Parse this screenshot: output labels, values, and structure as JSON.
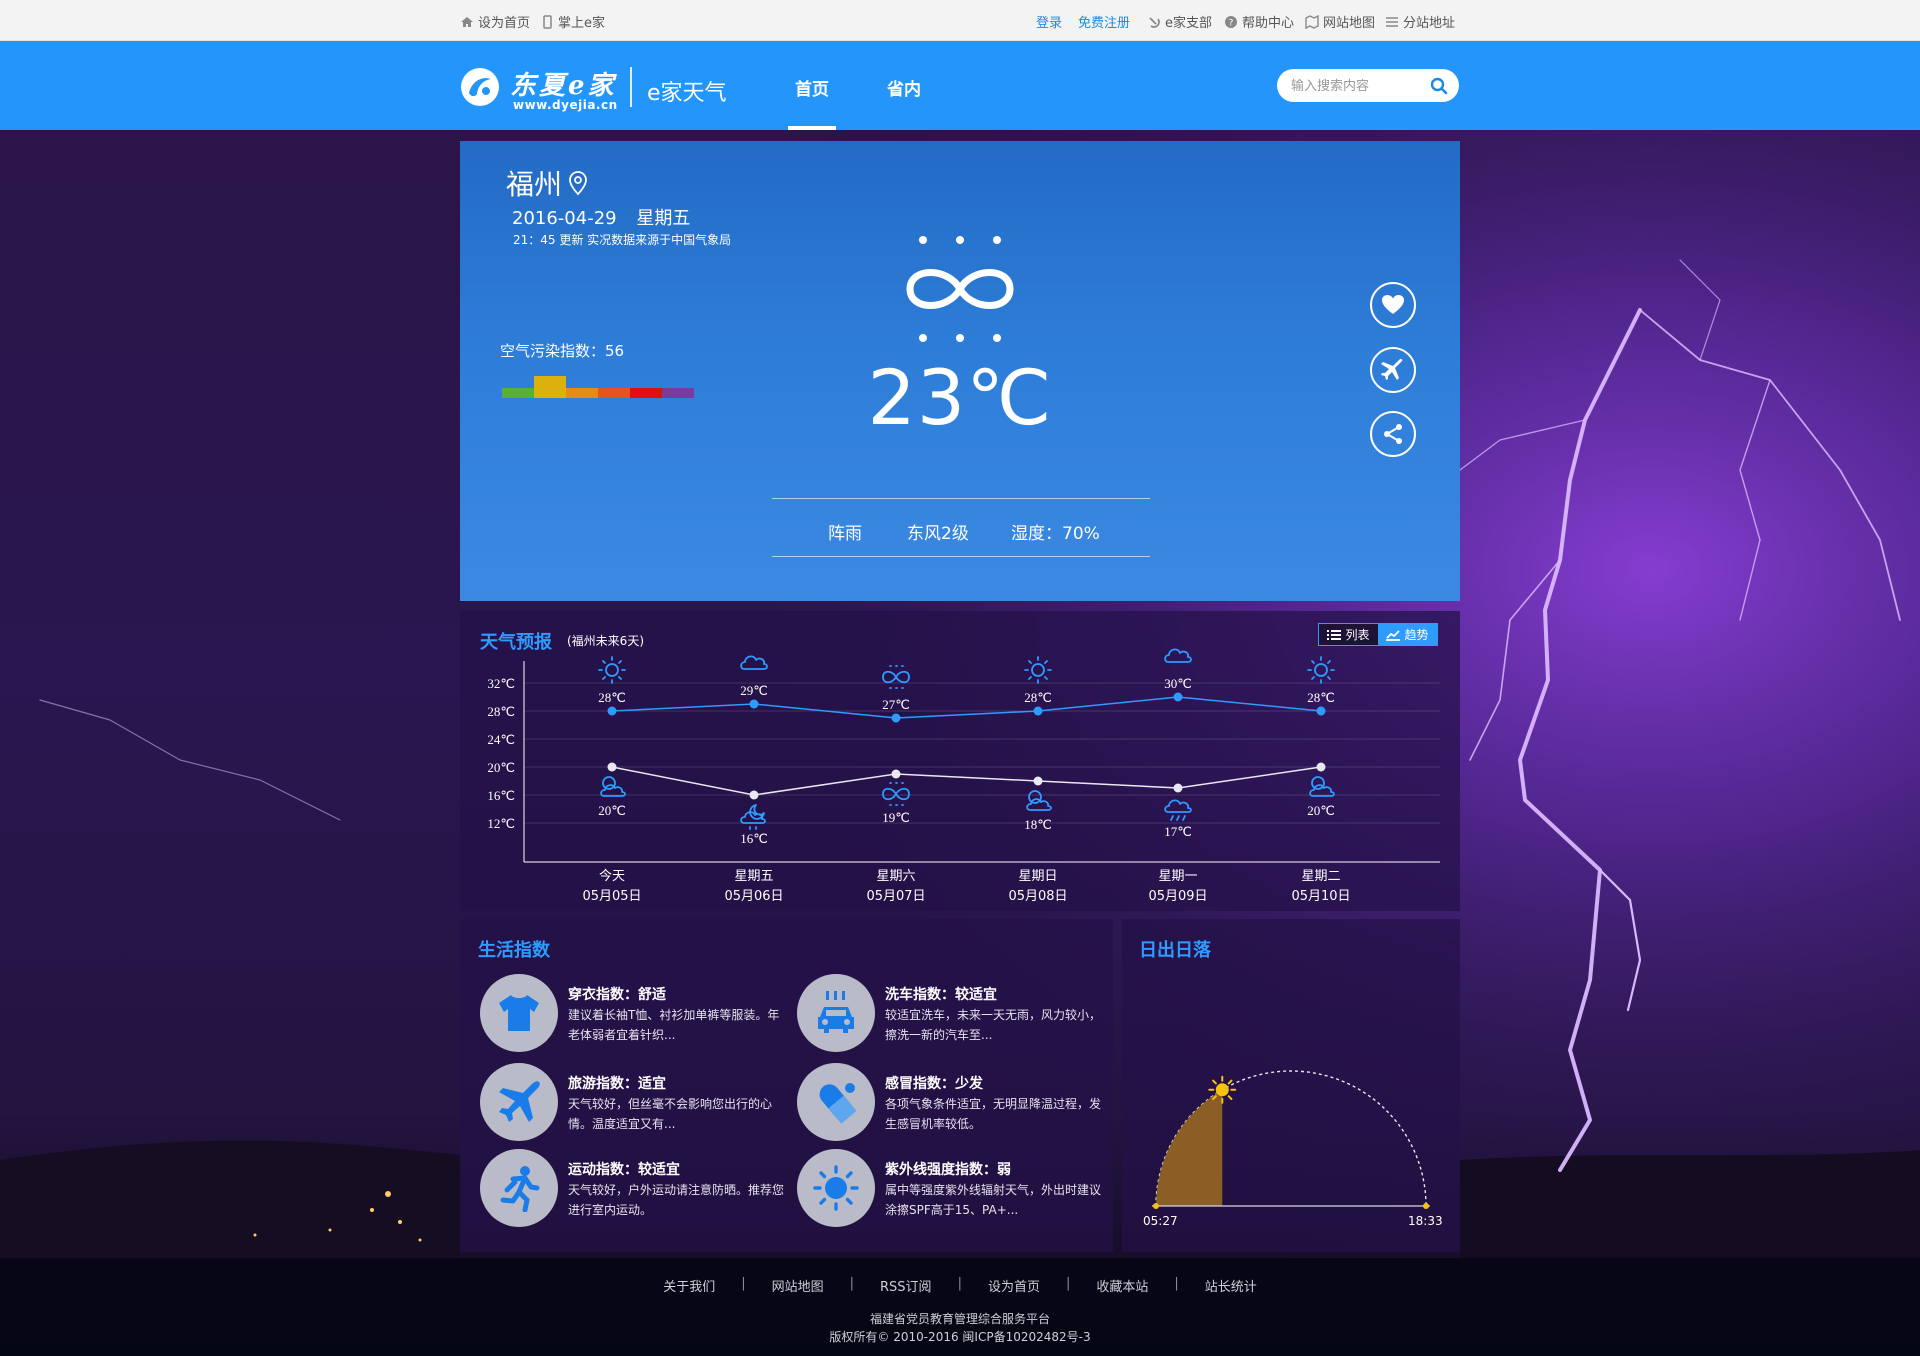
{
  "topbar": {
    "set_home": "设为首页",
    "mobile": "掌上e家",
    "login": "登录",
    "register": "免费注册",
    "branch": "e家支部",
    "help": "帮助中心",
    "sitemap": "网站地图",
    "substations": "分站地址"
  },
  "header": {
    "logo_text": "东夏e家",
    "logo_url": "www.dyejia.cn",
    "site_name": "e家天气",
    "nav": [
      "首页",
      "省内"
    ],
    "active_nav": "首页",
    "search_placeholder": "输入搜索内容"
  },
  "current": {
    "city": "福州",
    "date": "2016-04-29",
    "weekday": "星期五",
    "update": "21：45 更新 实况数据来源于中国气象局",
    "aqi_label": "空气污染指数：56",
    "aqi_value": 56,
    "aqi_colors": [
      "#5ab035",
      "#dcb10e",
      "#e8891b",
      "#e2561e",
      "#e01010",
      "#7a3aa0"
    ],
    "icon": "haze-icon",
    "temperature": "23℃",
    "condition": "阵雨",
    "wind": "东风2级",
    "humidity": "湿度：70%"
  },
  "forecast": {
    "title": "天气预报",
    "subtitle": "(福州未来6天)",
    "toggle_list": "列表",
    "toggle_trend": "趋势",
    "active_view": "趋势",
    "colors": {
      "high": "#2e9bff",
      "low": "#e8e8f0",
      "axis": "#ffffff"
    }
  },
  "chart_data": {
    "type": "line",
    "ylabels": [
      "32℃",
      "28℃",
      "24℃",
      "20℃",
      "16℃",
      "12℃"
    ],
    "yticks": [
      32,
      28,
      24,
      20,
      16,
      12
    ],
    "categories": [
      "今天",
      "星期五",
      "星期六",
      "星期日",
      "星期一",
      "星期二"
    ],
    "dates": [
      "05月05日",
      "05月06日",
      "05月07日",
      "05月08日",
      "05月09日",
      "05月10日"
    ],
    "series": [
      {
        "key": "high",
        "values": [
          28,
          29,
          27,
          28,
          30,
          28
        ],
        "labels": [
          "28℃",
          "29℃",
          "27℃",
          "28℃",
          "30℃",
          "28℃"
        ],
        "icons": [
          "sun-icon",
          "cloud-icon",
          "haze-icon",
          "sun-icon",
          "cloud-icon",
          "sun-icon"
        ]
      },
      {
        "key": "low",
        "values": [
          20,
          16,
          19,
          18,
          17,
          20
        ],
        "labels": [
          "20℃",
          "16℃",
          "19℃",
          "18℃",
          "17℃",
          "20℃"
        ],
        "icons": [
          "partly-cloudy-icon",
          "night-cloudy-icon",
          "haze-icon",
          "partly-cloudy-icon",
          "rain-night-icon",
          "partly-cloudy-icon"
        ]
      }
    ]
  },
  "life": {
    "title": "生活指数",
    "items": [
      {
        "icon": "tshirt-icon",
        "title": "穿衣指数：舒适",
        "desc": "建议着长袖T恤、衬衫加单裤等服装。年老体弱者宜着针织..."
      },
      {
        "icon": "car-wash-icon",
        "title": "洗车指数：较适宜",
        "desc": "较适宜洗车，未来一天无雨，风力较小，擦洗一新的汽车至..."
      },
      {
        "icon": "airplane-icon",
        "title": "旅游指数：适宜",
        "desc": "天气较好，但丝毫不会影响您出行的心情。温度适宜又有..."
      },
      {
        "icon": "pill-icon",
        "title": "感冒指数：少发",
        "desc": "各项气象条件适宜，无明显降温过程，发生感冒机率较低。"
      },
      {
        "icon": "running-icon",
        "title": "运动指数：较适宜",
        "desc": "天气较好，户外运动请注意防晒。推荐您进行室内运动。"
      },
      {
        "icon": "sun-uv-icon",
        "title": "紫外线强度指数：弱",
        "desc": "属中等强度紫外线辐射天气，外出时建议涂擦SPF高于15、PA+..."
      }
    ]
  },
  "sun": {
    "title": "日出日落",
    "sunrise": "05:27",
    "sunset": "18:33",
    "progress": 0.33,
    "fill_color": "#8a5e24",
    "sun_color": "#f5c20e"
  },
  "footer": {
    "links": [
      "关于我们",
      "网站地图",
      "RSS订阅",
      "设为首页",
      "收藏本站",
      "站长统计"
    ],
    "org": "福建省党员教育管理综合服务平台",
    "copyright": "版权所有© 2010-2016 闽ICP备10202482号-3"
  }
}
